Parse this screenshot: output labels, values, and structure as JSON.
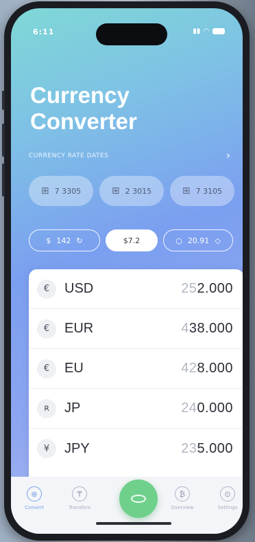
{
  "status": {
    "time": "6:11"
  },
  "header": {
    "title_line1": "Currency",
    "title_line2": "Converter",
    "subtitle": "CURRENCY RATE DATES"
  },
  "rates": [
    {
      "icon": "rate-icon",
      "label": "7 3305"
    },
    {
      "icon": "rate-icon",
      "label": "2 3015"
    },
    {
      "icon": "rate-icon",
      "label": "7 3105"
    }
  ],
  "tabs": [
    {
      "left": "$",
      "label": "142",
      "right": "↻"
    },
    {
      "label": "$7.2"
    },
    {
      "left": "○",
      "label": "20.91",
      "right": "◇"
    }
  ],
  "currencies": [
    {
      "symbol": "€",
      "code": "USD",
      "amount_faint": "25",
      "amount": "2.000"
    },
    {
      "symbol": "€",
      "code": "EUR",
      "amount_faint": "4",
      "amount": "38.000"
    },
    {
      "symbol": "€",
      "code": "EU",
      "amount_faint": "42",
      "amount": "8.000"
    },
    {
      "symbol": "ʀ",
      "code": "JP",
      "amount_faint": "24",
      "amount": "0.000"
    },
    {
      "symbol": "¥",
      "code": "JPY",
      "amount_faint": "23",
      "amount": "5.000"
    }
  ],
  "nav": [
    {
      "label": "Convert"
    },
    {
      "label": "Transfers"
    },
    {
      "label": "Overview"
    },
    {
      "label": "Settings"
    }
  ]
}
